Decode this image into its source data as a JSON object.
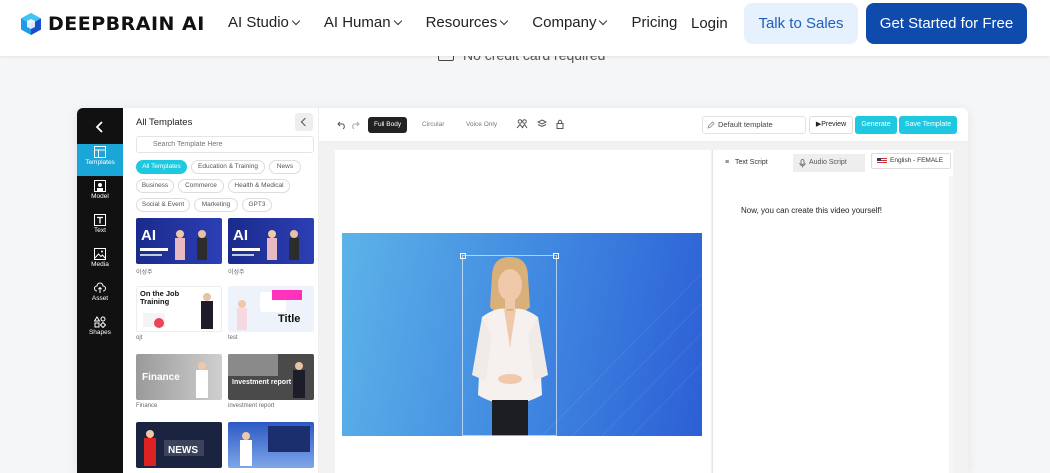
{
  "brand": {
    "name": "DEEPBRAIN AI",
    "accent": "#0f4aad",
    "cyan": "#1ec8e0"
  },
  "nav": {
    "items": [
      {
        "label": "AI Studio",
        "dropdown": true
      },
      {
        "label": "AI Human",
        "dropdown": true
      },
      {
        "label": "Resources",
        "dropdown": true
      },
      {
        "label": "Company",
        "dropdown": true
      },
      {
        "label": "Pricing",
        "dropdown": false
      }
    ],
    "login": "Login",
    "talk_to_sales": "Talk to Sales",
    "get_started": "Get Started for Free"
  },
  "hero": {
    "no_credit_card": "No credit card required"
  },
  "rail": {
    "items": [
      {
        "label": "Templates",
        "icon": "layout-icon",
        "active": true
      },
      {
        "label": "Model",
        "icon": "person-icon",
        "active": false
      },
      {
        "label": "Text",
        "icon": "text-icon",
        "active": false
      },
      {
        "label": "Media",
        "icon": "image-icon",
        "active": false
      },
      {
        "label": "Asset",
        "icon": "cloud-upload-icon",
        "active": false
      },
      {
        "label": "Shapes",
        "icon": "shapes-icon",
        "active": false
      }
    ]
  },
  "templates": {
    "title": "All Templates",
    "search_placeholder": "Search Template Here",
    "chips": [
      {
        "label": "All Templates",
        "active": true
      },
      {
        "label": "Education & Training",
        "active": false
      },
      {
        "label": "News",
        "active": false
      },
      {
        "label": "Business",
        "active": false
      },
      {
        "label": "Commerce",
        "active": false
      },
      {
        "label": "Health & Medical",
        "active": false
      },
      {
        "label": "Social & Event",
        "active": false
      },
      {
        "label": "Marketing",
        "active": false
      },
      {
        "label": "GPT3",
        "active": false
      }
    ],
    "cards": [
      {
        "caption": "이성주",
        "overlay": "AI"
      },
      {
        "caption": "이성주",
        "overlay": "AI"
      },
      {
        "caption": "ojt",
        "overlay": "On the Job Training"
      },
      {
        "caption": "test",
        "overlay": "Title"
      },
      {
        "caption": "Finance",
        "overlay": "Finance"
      },
      {
        "caption": "investment report",
        "overlay": "Investment report"
      },
      {
        "caption": "",
        "overlay": "NEWS"
      },
      {
        "caption": "",
        "overlay": ""
      }
    ]
  },
  "toolbar": {
    "modes": [
      {
        "label": "Full Body",
        "active": true
      },
      {
        "label": "Circular",
        "active": false
      },
      {
        "label": "Voice Only",
        "active": false
      }
    ],
    "template_name": "Default template",
    "preview": "Preview",
    "generate": "Generate",
    "save_template": "Save Template"
  },
  "script": {
    "tab_text": "Text Script",
    "tab_audio": "Audio Script",
    "language": "English - FEMALE",
    "content": "Now, you can create this video yourself!"
  }
}
